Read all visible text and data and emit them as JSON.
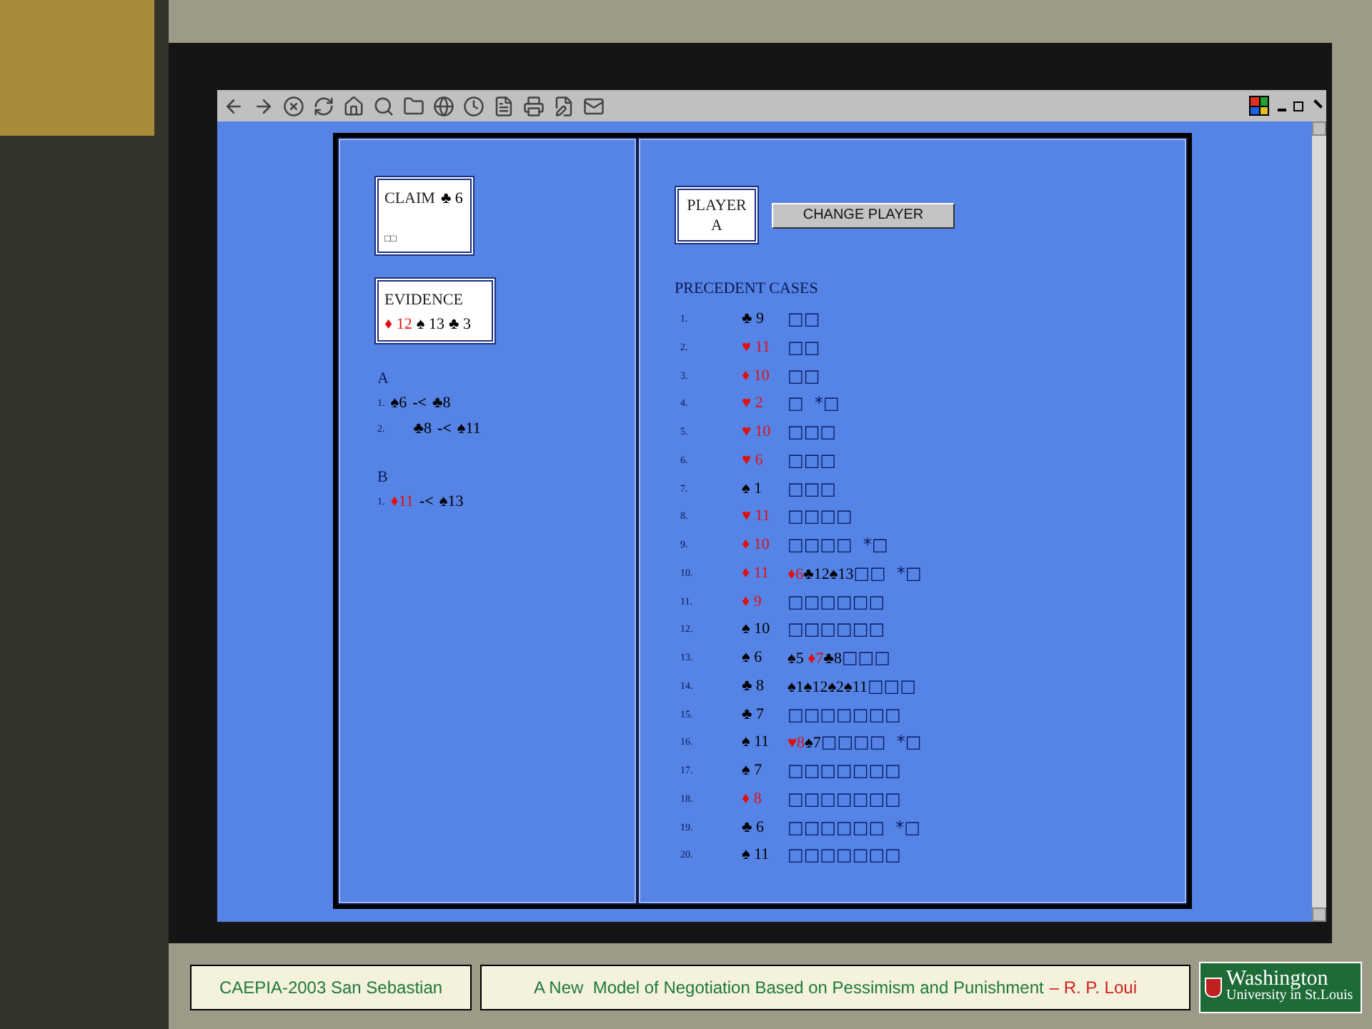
{
  "claim": {
    "label": "CLAIM",
    "card": [
      {
        "text": "♣ 6",
        "red": false
      }
    ],
    "note": "□□"
  },
  "evidence": {
    "label": "EVIDENCE",
    "cards": [
      {
        "text": "♦ 12",
        "red": true
      },
      {
        "text": "♠ 13",
        "red": false
      },
      {
        "text": "♣ 3",
        "red": false
      }
    ]
  },
  "arguments": [
    {
      "player": "A",
      "lines": [
        {
          "number": "1.",
          "from": {
            "text": "♠6",
            "red": false
          },
          "relation": "-<",
          "to": {
            "text": "♣8",
            "red": false
          },
          "indented": false
        },
        {
          "number": "2.",
          "from": {
            "text": "♣8",
            "red": false
          },
          "relation": "-<",
          "to": {
            "text": "♠11",
            "red": false
          },
          "indented": true
        }
      ]
    },
    {
      "player": "B",
      "lines": [
        {
          "number": "1.",
          "from": {
            "text": "♦11",
            "red": true
          },
          "relation": "-<",
          "to": {
            "text": "♠13",
            "red": false
          },
          "indented": false
        }
      ]
    }
  ],
  "player_box": {
    "label": "PLAYER",
    "value": "A"
  },
  "change_player_button": "CHANGE PLAYER",
  "precedents": {
    "title": "PRECEDENT CASES",
    "rows": [
      {
        "number": "1.",
        "card": {
          "text": "♣ 9",
          "red": false
        },
        "detail": [
          {
            "text": "□□",
            "kind": "box"
          }
        ]
      },
      {
        "number": "2.",
        "card": {
          "text": "♥ 11",
          "red": true
        },
        "detail": [
          {
            "text": "□□",
            "kind": "box"
          }
        ]
      },
      {
        "number": "3.",
        "card": {
          "text": "♦ 10",
          "red": true
        },
        "detail": [
          {
            "text": "□□",
            "kind": "box"
          }
        ]
      },
      {
        "number": "4.",
        "card": {
          "text": "♥ 2",
          "red": true
        },
        "detail": [
          {
            "text": "□  *□",
            "kind": "box"
          }
        ]
      },
      {
        "number": "5.",
        "card": {
          "text": "♥ 10",
          "red": true
        },
        "detail": [
          {
            "text": "□□□",
            "kind": "box"
          }
        ]
      },
      {
        "number": "6.",
        "card": {
          "text": "♥ 6",
          "red": true
        },
        "detail": [
          {
            "text": "□□□",
            "kind": "box"
          }
        ]
      },
      {
        "number": "7.",
        "card": {
          "text": "♠ 1",
          "red": false
        },
        "detail": [
          {
            "text": "□□□",
            "kind": "box"
          }
        ]
      },
      {
        "number": "8.",
        "card": {
          "text": "♥ 11",
          "red": true
        },
        "detail": [
          {
            "text": "□□□□",
            "kind": "box"
          }
        ]
      },
      {
        "number": "9.",
        "card": {
          "text": "♦ 10",
          "red": true
        },
        "detail": [
          {
            "text": "□□□□  *□",
            "kind": "box"
          }
        ]
      },
      {
        "number": "10.",
        "card": {
          "text": "♦ 11",
          "red": true
        },
        "detail": [
          {
            "text": "♦6",
            "kind": "red"
          },
          {
            "text": "♣12♠13",
            "kind": "black"
          },
          {
            "text": "□□  *□",
            "kind": "box"
          }
        ]
      },
      {
        "number": "11.",
        "card": {
          "text": "♦ 9",
          "red": true
        },
        "detail": [
          {
            "text": "□□□□□□",
            "kind": "box"
          }
        ]
      },
      {
        "number": "12.",
        "card": {
          "text": "♠ 10",
          "red": false
        },
        "detail": [
          {
            "text": "□□□□□□",
            "kind": "box"
          }
        ]
      },
      {
        "number": "13.",
        "card": {
          "text": "♠ 6",
          "red": false
        },
        "detail": [
          {
            "text": "♠5 ",
            "kind": "black"
          },
          {
            "text": "♦7",
            "kind": "red"
          },
          {
            "text": "♣8",
            "kind": "black"
          },
          {
            "text": "□□□",
            "kind": "box"
          }
        ]
      },
      {
        "number": "14.",
        "card": {
          "text": "♣ 8",
          "red": false
        },
        "detail": [
          {
            "text": "♠1♠12♠2♠11",
            "kind": "black"
          },
          {
            "text": "□□□",
            "kind": "box"
          }
        ]
      },
      {
        "number": "15.",
        "card": {
          "text": "♣ 7",
          "red": false
        },
        "detail": [
          {
            "text": "□□□□□□□",
            "kind": "box"
          }
        ]
      },
      {
        "number": "16.",
        "card": {
          "text": "♠ 11",
          "red": false
        },
        "detail": [
          {
            "text": "♥8",
            "kind": "red"
          },
          {
            "text": "♠7",
            "kind": "black"
          },
          {
            "text": "□□□□  *□",
            "kind": "box"
          }
        ]
      },
      {
        "number": "17.",
        "card": {
          "text": "♠ 7",
          "red": false
        },
        "detail": [
          {
            "text": "□□□□□□□",
            "kind": "box"
          }
        ]
      },
      {
        "number": "18.",
        "card": {
          "text": "♦ 8",
          "red": true
        },
        "detail": [
          {
            "text": "□□□□□□□",
            "kind": "box"
          }
        ]
      },
      {
        "number": "19.",
        "card": {
          "text": "♣ 6",
          "red": false
        },
        "detail": [
          {
            "text": "□□□□□□  *□",
            "kind": "box"
          }
        ]
      },
      {
        "number": "20.",
        "card": {
          "text": "♠ 11",
          "red": false
        },
        "detail": [
          {
            "text": "□□□□□□□",
            "kind": "box"
          }
        ]
      }
    ]
  },
  "footer": {
    "conference": "CAEPIA-2003  San Sebastian",
    "title": "A New  Model of Negotiation Based on Pessimism and Punishment",
    "author": "– R. P. Loui",
    "logo_name": "Washington",
    "logo_sub": "University in St.Louis"
  }
}
